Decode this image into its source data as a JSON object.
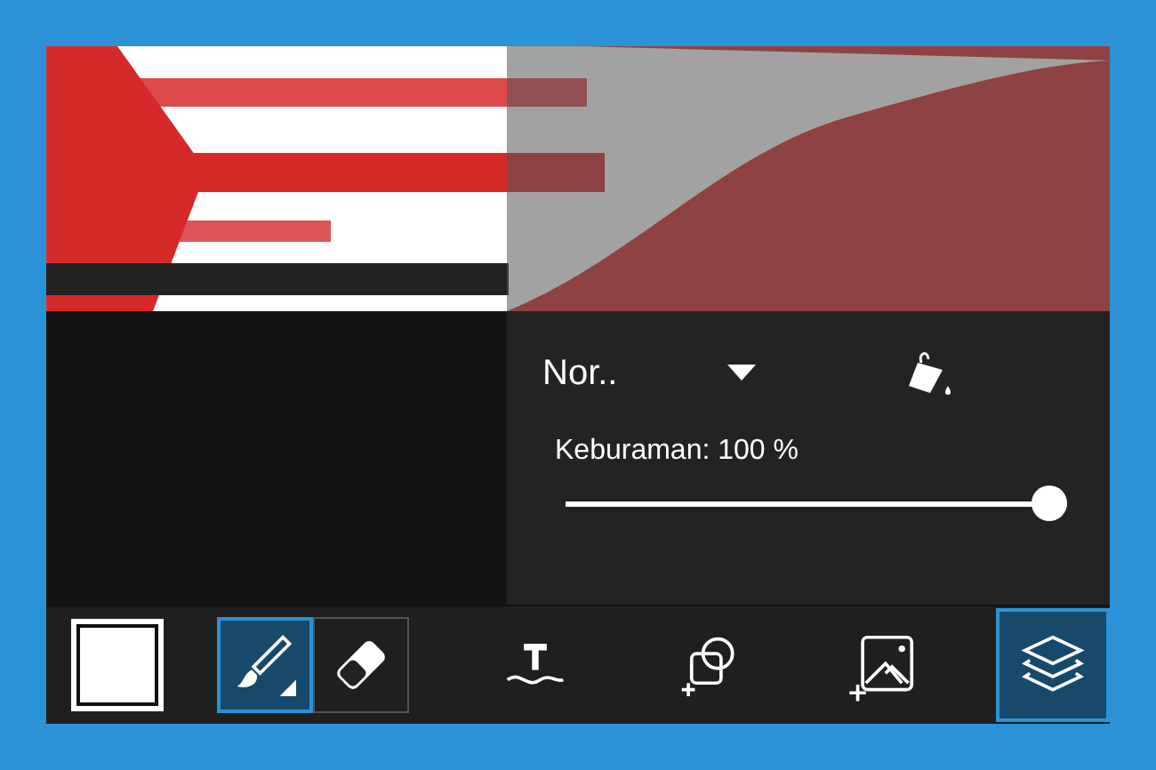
{
  "layer_panel": {
    "blend_mode": "Nor..",
    "opacity_label": "Keburaman: 100 %",
    "opacity": {
      "level": 1.0
    }
  },
  "toolbar": [
    {
      "kind": "color",
      "selected": false
    },
    {
      "kind": "brush",
      "selected": true
    },
    {
      "kind": "eraser",
      "selected": false
    },
    {
      "kind": "text",
      "selected": false
    },
    {
      "kind": "shape",
      "selected": false
    },
    {
      "kind": "image",
      "selected": false
    },
    {
      "kind": "layers",
      "selected": true
    }
  ]
}
